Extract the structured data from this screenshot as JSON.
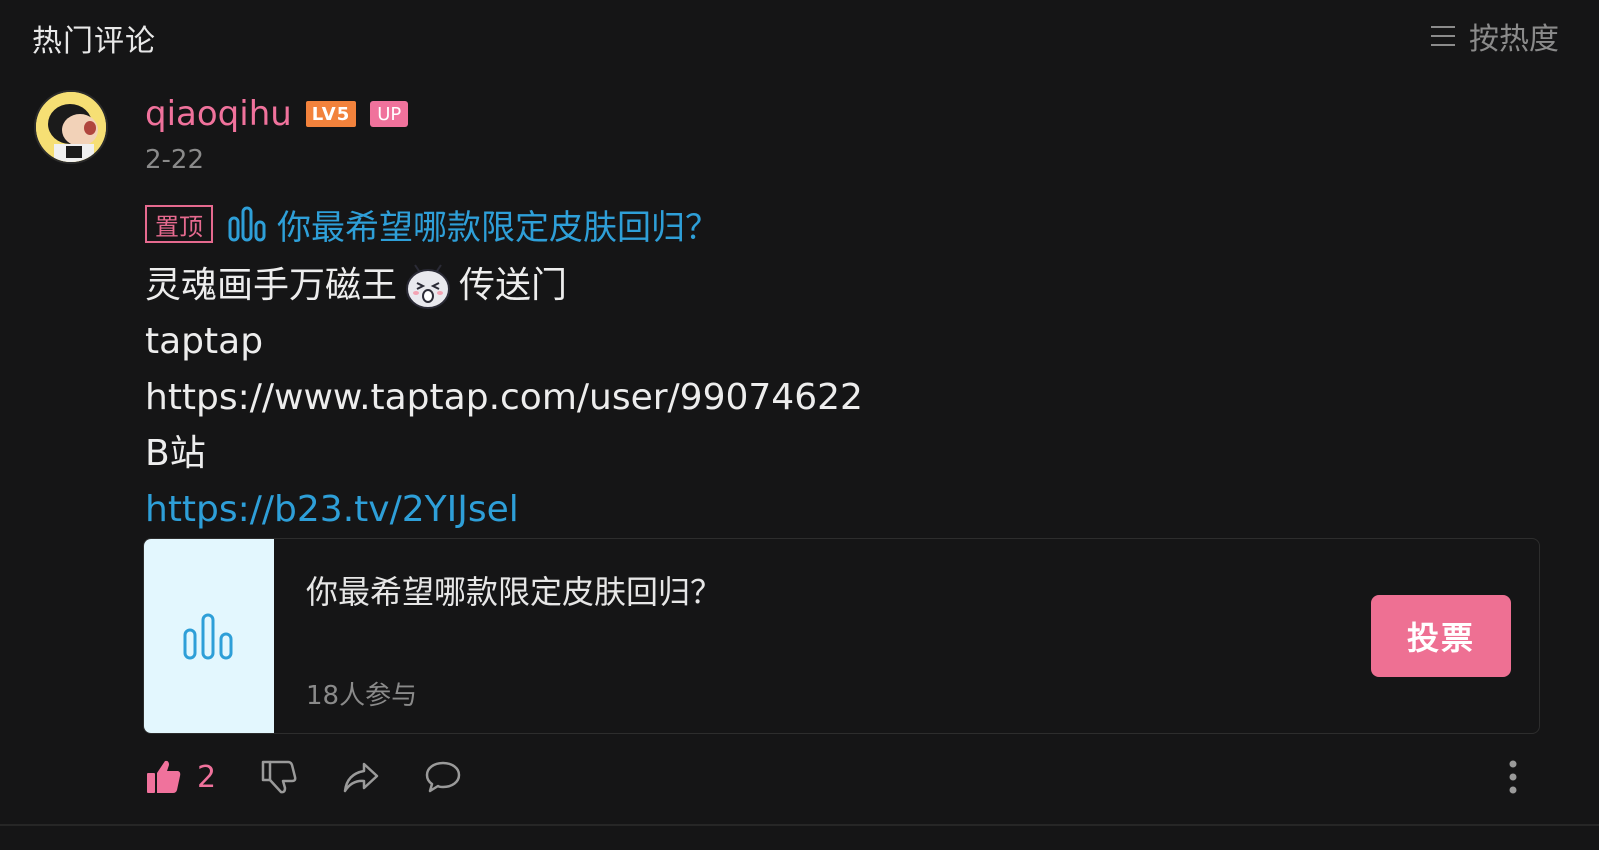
{
  "header": {
    "section_title": "热门评论",
    "sort_label": "按热度"
  },
  "comment": {
    "username": "qiaoqihu",
    "level_badge": "LV5",
    "up_badge": "UP",
    "date": "2-22",
    "pin_tag": "置顶",
    "vote_title_link": "你最希望哪款限定皮肤回归？",
    "content_lines": {
      "line1_before_emoji": "灵魂画手万磁王",
      "line1_after_emoji": "传送门",
      "line2": "taptap",
      "line3": "https://www.taptap.com/user/99074622",
      "line4": "B站",
      "line5_link": "https://b23.tv/2YIJsel"
    },
    "vote_card": {
      "title": "你最希望哪款限定皮肤回归？",
      "participants": "18人参与",
      "button_label": "投票"
    },
    "actions": {
      "like_count": "2"
    }
  },
  "colors": {
    "background": "#151516",
    "accent_pink": "#f0729c",
    "link_blue": "#2e9fd8",
    "level_orange": "#f2823c",
    "muted_gray": "#8a8a8a"
  },
  "icons": [
    "menu-lines-icon",
    "bar-chart-icon",
    "thumbs-up-icon",
    "thumbs-down-icon",
    "share-icon",
    "comment-icon",
    "more-vertical-icon",
    "emoji-face-icon"
  ]
}
